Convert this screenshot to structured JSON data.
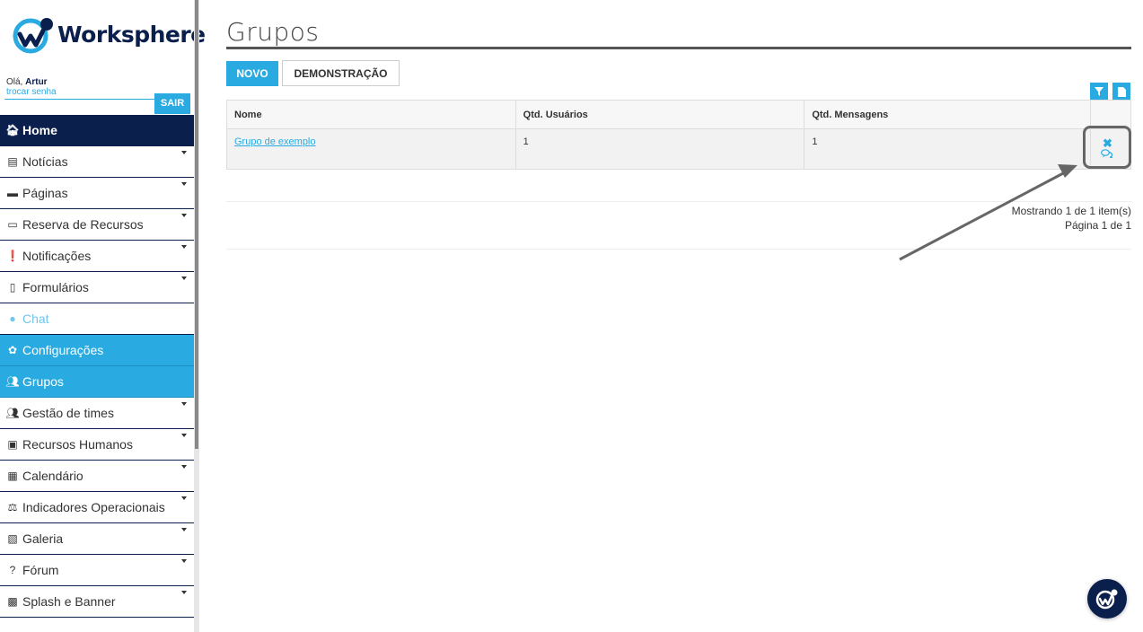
{
  "brand": {
    "name": "Worksphere"
  },
  "user": {
    "greeting": "Olá,",
    "name": "Artur",
    "change_password": "trocar senha",
    "logout": "SAIR"
  },
  "sidebar": {
    "items": [
      {
        "label": "Home",
        "icon": "home-icon",
        "state": "home"
      },
      {
        "label": "Notícias",
        "icon": "newspaper-icon"
      },
      {
        "label": "Páginas",
        "icon": "window-icon"
      },
      {
        "label": "Reserva de Recursos",
        "icon": "laptop-icon"
      },
      {
        "label": "Notificações",
        "icon": "exclamation-icon"
      },
      {
        "label": "Formulários",
        "icon": "file-icon"
      },
      {
        "label": "Chat",
        "icon": "chat-icon",
        "state": "chat"
      },
      {
        "label": "Configurações",
        "icon": "gear-icon",
        "state": "active"
      },
      {
        "label": "Grupos",
        "icon": "users-icon",
        "state": "active"
      },
      {
        "label": "Gestão de times",
        "icon": "users-icon"
      },
      {
        "label": "Recursos Humanos",
        "icon": "id-badge-icon"
      },
      {
        "label": "Calendário",
        "icon": "calendar-icon"
      },
      {
        "label": "Indicadores Operacionais",
        "icon": "balance-icon"
      },
      {
        "label": "Galeria",
        "icon": "image-icon"
      },
      {
        "label": "Fórum",
        "icon": "question-icon"
      },
      {
        "label": "Splash e Banner",
        "icon": "picture-frame-icon"
      }
    ]
  },
  "main": {
    "title": "Grupos",
    "buttons": {
      "new": "NOVO",
      "demo": "DEMONSTRAÇÃO"
    },
    "table": {
      "headers": [
        "Nome",
        "Qtd. Usuários",
        "Qtd. Mensagens"
      ],
      "rows": [
        {
          "name": "Grupo de exemplo",
          "users": "1",
          "messages": "1"
        }
      ]
    },
    "pagination": {
      "showing": "Mostrando 1 de 1 item(s)",
      "page": "Página 1 de 1"
    }
  },
  "colors": {
    "primary": "#29abe2",
    "navy": "#0b1f4d"
  }
}
